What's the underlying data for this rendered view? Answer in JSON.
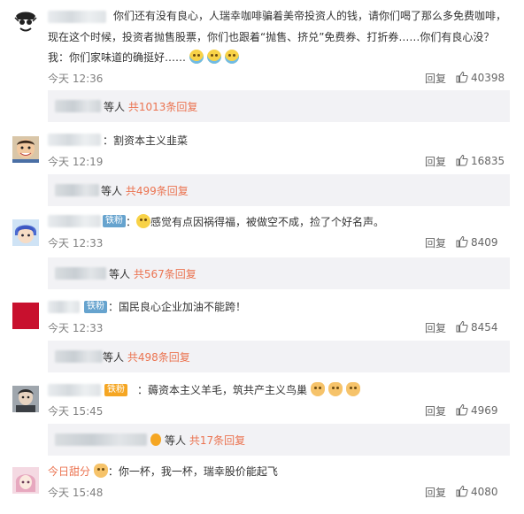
{
  "comments": [
    {
      "text_line1": "你们还有没有良心，人瑞幸咖啡骗着美帝投资人的钱，请你们喝了那么多免费咖啡，",
      "text_line2": "现在这个时候，投资者抛售股票，你们也跟着“抛售、挤兑”免费券、打折券……你们有良心没？",
      "text_line3": "我：你们家味道的确挺好……",
      "time": "今天 12:36",
      "reply_label": "回复",
      "likes": "40398",
      "sub_text": "等人",
      "sub_link": "共1013条回复"
    },
    {
      "text_line1": "：割资本主义韭菜",
      "time": "今天 12:19",
      "reply_label": "回复",
      "likes": "16835",
      "sub_text": "等人",
      "sub_link": "共499条回复"
    },
    {
      "badge": "铁粉",
      "text_line1": "感觉有点因祸得福，被做空不成，捡了个好名声。",
      "time": "今天 12:33",
      "reply_label": "回复",
      "likes": "8409",
      "sub_text": "等人",
      "sub_link": "共567条回复"
    },
    {
      "badge": "铁粉",
      "text_line1": "：国民良心企业加油不能跨！",
      "time": "今天 12:33",
      "reply_label": "回复",
      "likes": "8454",
      "sub_text": "等人",
      "sub_link": "共498条回复"
    },
    {
      "badge": "铁粉",
      "text_line1": "：薅资本主义羊毛，筑共产主义鸟巢",
      "time": "今天 15:45",
      "reply_label": "回复",
      "likes": "4969",
      "sub_text": "等人",
      "sub_link": "共17条回复"
    },
    {
      "username": "今日甜分",
      "text_line1": "：你一杯，我一杯，瑞幸股价能起飞",
      "time": "今天 15:48",
      "reply_label": "回复",
      "likes": "4080"
    }
  ],
  "colors": {
    "link": "#eb7350",
    "meta": "#808080",
    "sub_bg": "#f2f2f5",
    "badge_iron": "#66a3ce",
    "badge_gold": "#f5a623"
  },
  "icons": [
    "like-thumb-icon",
    "emoji-cry-icon",
    "emoji-smile-icon",
    "emoji-dog-icon"
  ]
}
